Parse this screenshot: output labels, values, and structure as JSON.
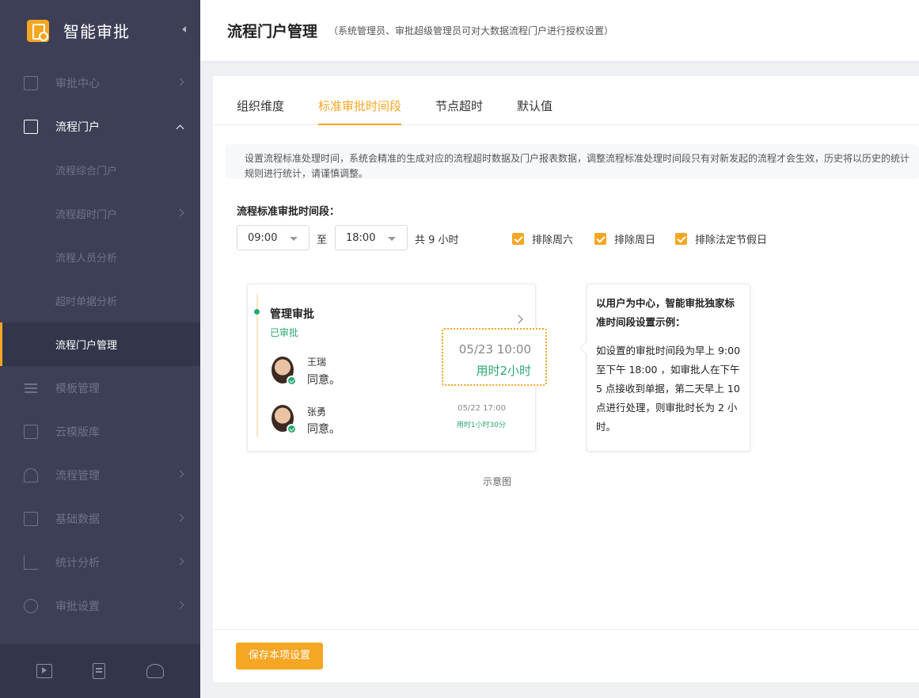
{
  "app": {
    "title": "智能审批"
  },
  "sidebar": {
    "items": [
      {
        "label": "审批中心",
        "icon": "doc-icon"
      },
      {
        "label": "流程门户",
        "icon": "monitor-icon"
      },
      {
        "label": "模板管理",
        "icon": "list-icon"
      },
      {
        "label": "云模版库",
        "icon": "copy-icon"
      },
      {
        "label": "流程管理",
        "icon": "tree-icon"
      },
      {
        "label": "基础数据",
        "icon": "database-icon"
      },
      {
        "label": "统计分析",
        "icon": "bar-chart-icon"
      },
      {
        "label": "审批设置",
        "icon": "gear-icon"
      }
    ],
    "sub_items": [
      {
        "label": "流程综合门户"
      },
      {
        "label": "流程超时门户"
      },
      {
        "label": "流程人员分析"
      },
      {
        "label": "超时单据分析"
      },
      {
        "label": "流程门户管理"
      }
    ]
  },
  "header": {
    "title": "流程门户管理",
    "subtitle": "（系统管理员、审批超级管理员可对大数据流程门户进行授权设置）"
  },
  "tabs": [
    {
      "label": "组织维度",
      "active": false
    },
    {
      "label": "标准审批时间段",
      "active": true
    },
    {
      "label": "节点超时",
      "active": false
    },
    {
      "label": "默认值",
      "active": false
    }
  ],
  "notice": {
    "text": "设置流程标准处理时间，系统会精准的生成对应的流程超时数据及门户报表数据，调整流程标准处理时间段只有对新发起的流程才会生效，历史将以历史的统计规则进行统计，请谨慎调整。"
  },
  "time_range": {
    "label": "流程标准审批时间段：",
    "start": "09:00",
    "to_label": "至",
    "end": "18:00",
    "total": "共 9 小时",
    "options": [
      {
        "label": "排除周六",
        "checked": true
      },
      {
        "label": "排除周日",
        "checked": true
      },
      {
        "label": "排除法定节假日",
        "checked": true
      }
    ]
  },
  "example": {
    "node_title": "管理审批",
    "node_status": "已审批",
    "approvers": [
      {
        "name": "王瑞",
        "comment": "同意。"
      },
      {
        "name": "张勇",
        "comment": "同意。",
        "time": "05/22 17:00",
        "duration": "用时1小时30分"
      }
    ],
    "popout": {
      "time": "05/23 10:00",
      "duration": "用时2小时"
    },
    "explain_title": "以用户为中心，智能审批独家标准时间段设置示例：",
    "explain_body": "如设置的审批时间段为早上 9:00 至下午 18:00 ，如审批人在下午 5 点接收到单据，第二天早上 10 点进行处理，则审批时长为 2 小时。",
    "caption": "示意图"
  },
  "footer": {
    "save_label": "保存本项设置"
  },
  "colors": {
    "accent": "#f5a623",
    "sidebar": "#3c3f55",
    "success": "#2aa872"
  }
}
